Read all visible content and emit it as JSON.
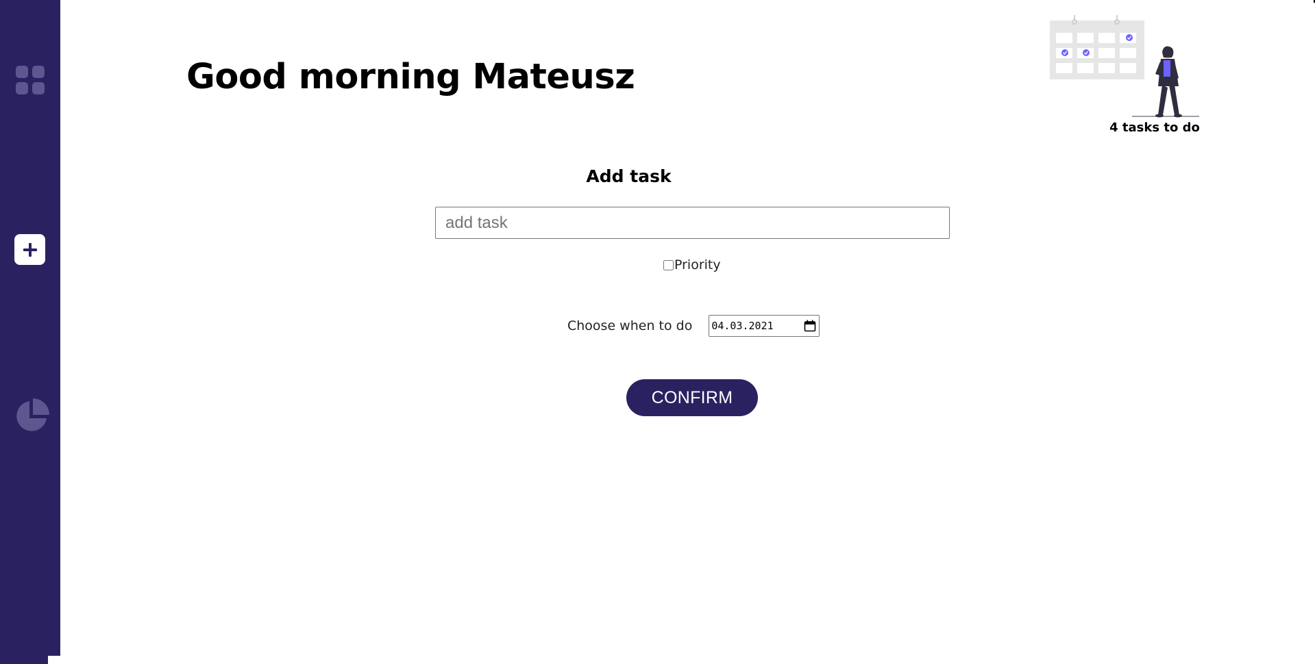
{
  "greeting": "Good morning Mateusz",
  "tasks_count": "4 tasks to do",
  "form": {
    "title": "Add task",
    "task_placeholder": "add task",
    "priority_label": "Priority",
    "priority_checked": false,
    "date_label": "Choose when to do",
    "date_value": "04.03.2021",
    "confirm_label": "CONFIRM"
  },
  "sidebar": {
    "items": [
      {
        "name": "dashboard",
        "icon": "grid-icon"
      },
      {
        "name": "add-task",
        "icon": "plus-icon",
        "active": true
      },
      {
        "name": "statistics",
        "icon": "pie-chart-icon"
      }
    ]
  },
  "colors": {
    "primary": "#2a2260",
    "sidebar_icon_muted": "#5e568f",
    "illustration_accent": "#6c63ff",
    "illustration_grey": "#e6e6e6",
    "illustration_dark": "#2f2e41"
  }
}
